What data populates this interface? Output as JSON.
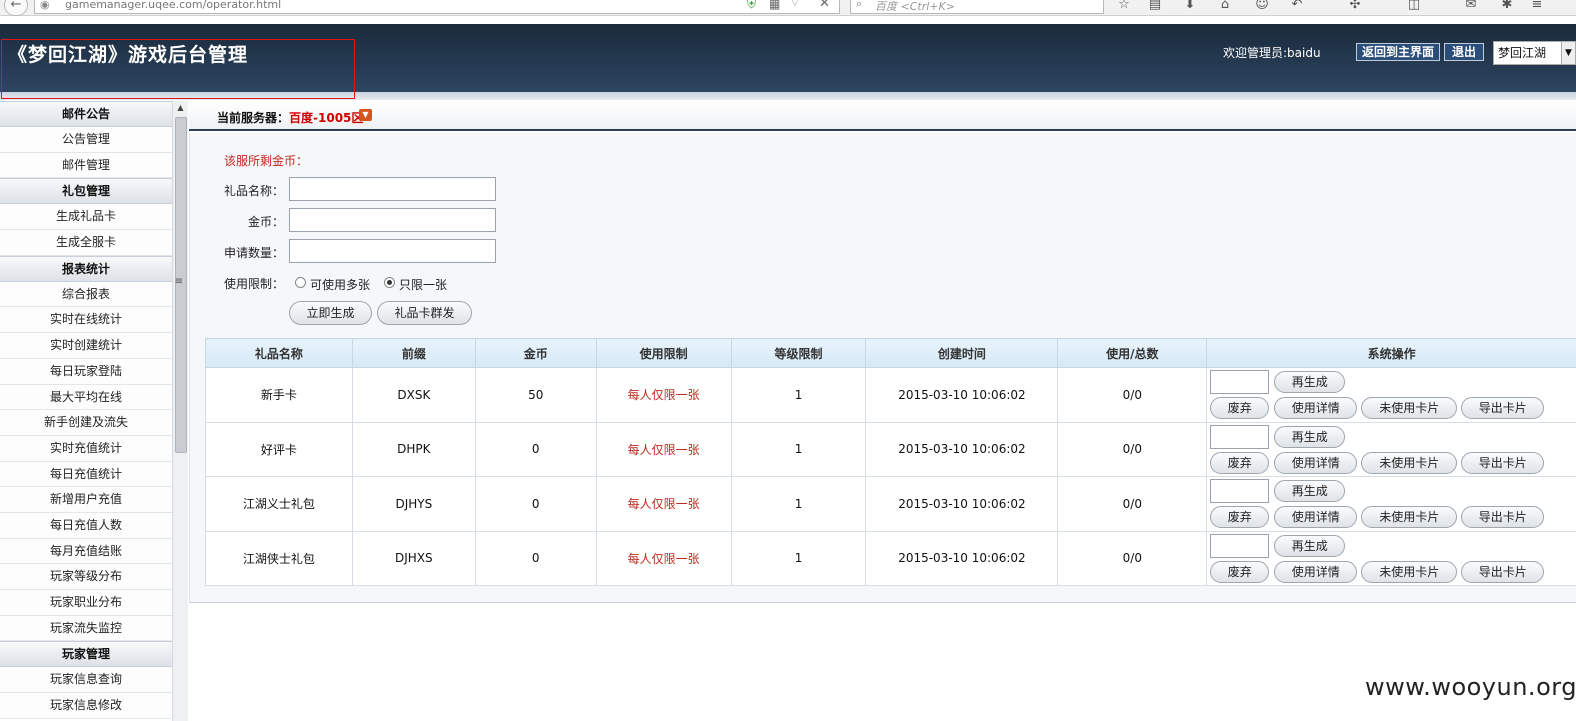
{
  "browser": {
    "url": "gamemanager.uqee.com/operator.html",
    "search_placeholder": "百度 <Ctrl+K>"
  },
  "header": {
    "title": "《梦回江湖》游戏后台管理",
    "welcome": "欢迎管理员:baidu",
    "back_button": "返回到主界面",
    "logout_button": "退出",
    "game_select": "梦回江湖"
  },
  "sidebar": {
    "groups": [
      {
        "title": "邮件公告",
        "items": [
          "公告管理",
          "邮件管理"
        ]
      },
      {
        "title": "礼包管理",
        "items": [
          "生成礼品卡",
          "生成全服卡"
        ]
      },
      {
        "title": "报表统计",
        "items": [
          "综合报表",
          "实时在线统计",
          "实时创建统计",
          "每日玩家登陆",
          "最大平均在线",
          "新手创建及流失",
          "实时充值统计",
          "每日充值统计",
          "新增用户充值",
          "每日充值人数",
          "每月充值结账",
          "玩家等级分布",
          "玩家职业分布",
          "玩家流失监控"
        ]
      },
      {
        "title": "玩家管理",
        "items": [
          "玩家信息查询",
          "玩家信息修改"
        ]
      }
    ]
  },
  "server": {
    "label": "当前服务器：",
    "name": "百度-1005区"
  },
  "form": {
    "gold_remaining_label": "该服所剩金币：",
    "name_label": "礼品名称：",
    "gold_label": "金币：",
    "quantity_label": "申请数量：",
    "limit_label": "使用限制：",
    "option_multi": "可使用多张",
    "option_single": "只限一张",
    "selected_option": "只限一张",
    "generate_button": "立即生成",
    "broadcast_button": "礼品卡群发"
  },
  "table": {
    "headers": [
      "礼品名称",
      "前缀",
      "金币",
      "使用限制",
      "等级限制",
      "创建时间",
      "使用/总数",
      "系统操作"
    ],
    "rows": [
      {
        "name": "新手卡",
        "prefix": "DXSK",
        "gold": "50",
        "limit": "每人仅限一张",
        "level": "1",
        "created": "2015-03-10 10:06:02",
        "usage": "0/0"
      },
      {
        "name": "好评卡",
        "prefix": "DHPK",
        "gold": "0",
        "limit": "每人仅限一张",
        "level": "1",
        "created": "2015-03-10 10:06:02",
        "usage": "0/0"
      },
      {
        "name": "江湖义士礼包",
        "prefix": "DJHYS",
        "gold": "0",
        "limit": "每人仅限一张",
        "level": "1",
        "created": "2015-03-10 10:06:02",
        "usage": "0/0"
      },
      {
        "name": "江湖侠士礼包",
        "prefix": "DJHXS",
        "gold": "0",
        "limit": "每人仅限一张",
        "level": "1",
        "created": "2015-03-10 10:06:02",
        "usage": "0/0"
      }
    ],
    "actions": {
      "regenerate": "再生成",
      "discard": "废弃",
      "usage_details": "使用详情",
      "unused_cards": "未使用卡片",
      "export_cards": "导出卡片"
    }
  },
  "watermark": "www.wooyun.org"
}
